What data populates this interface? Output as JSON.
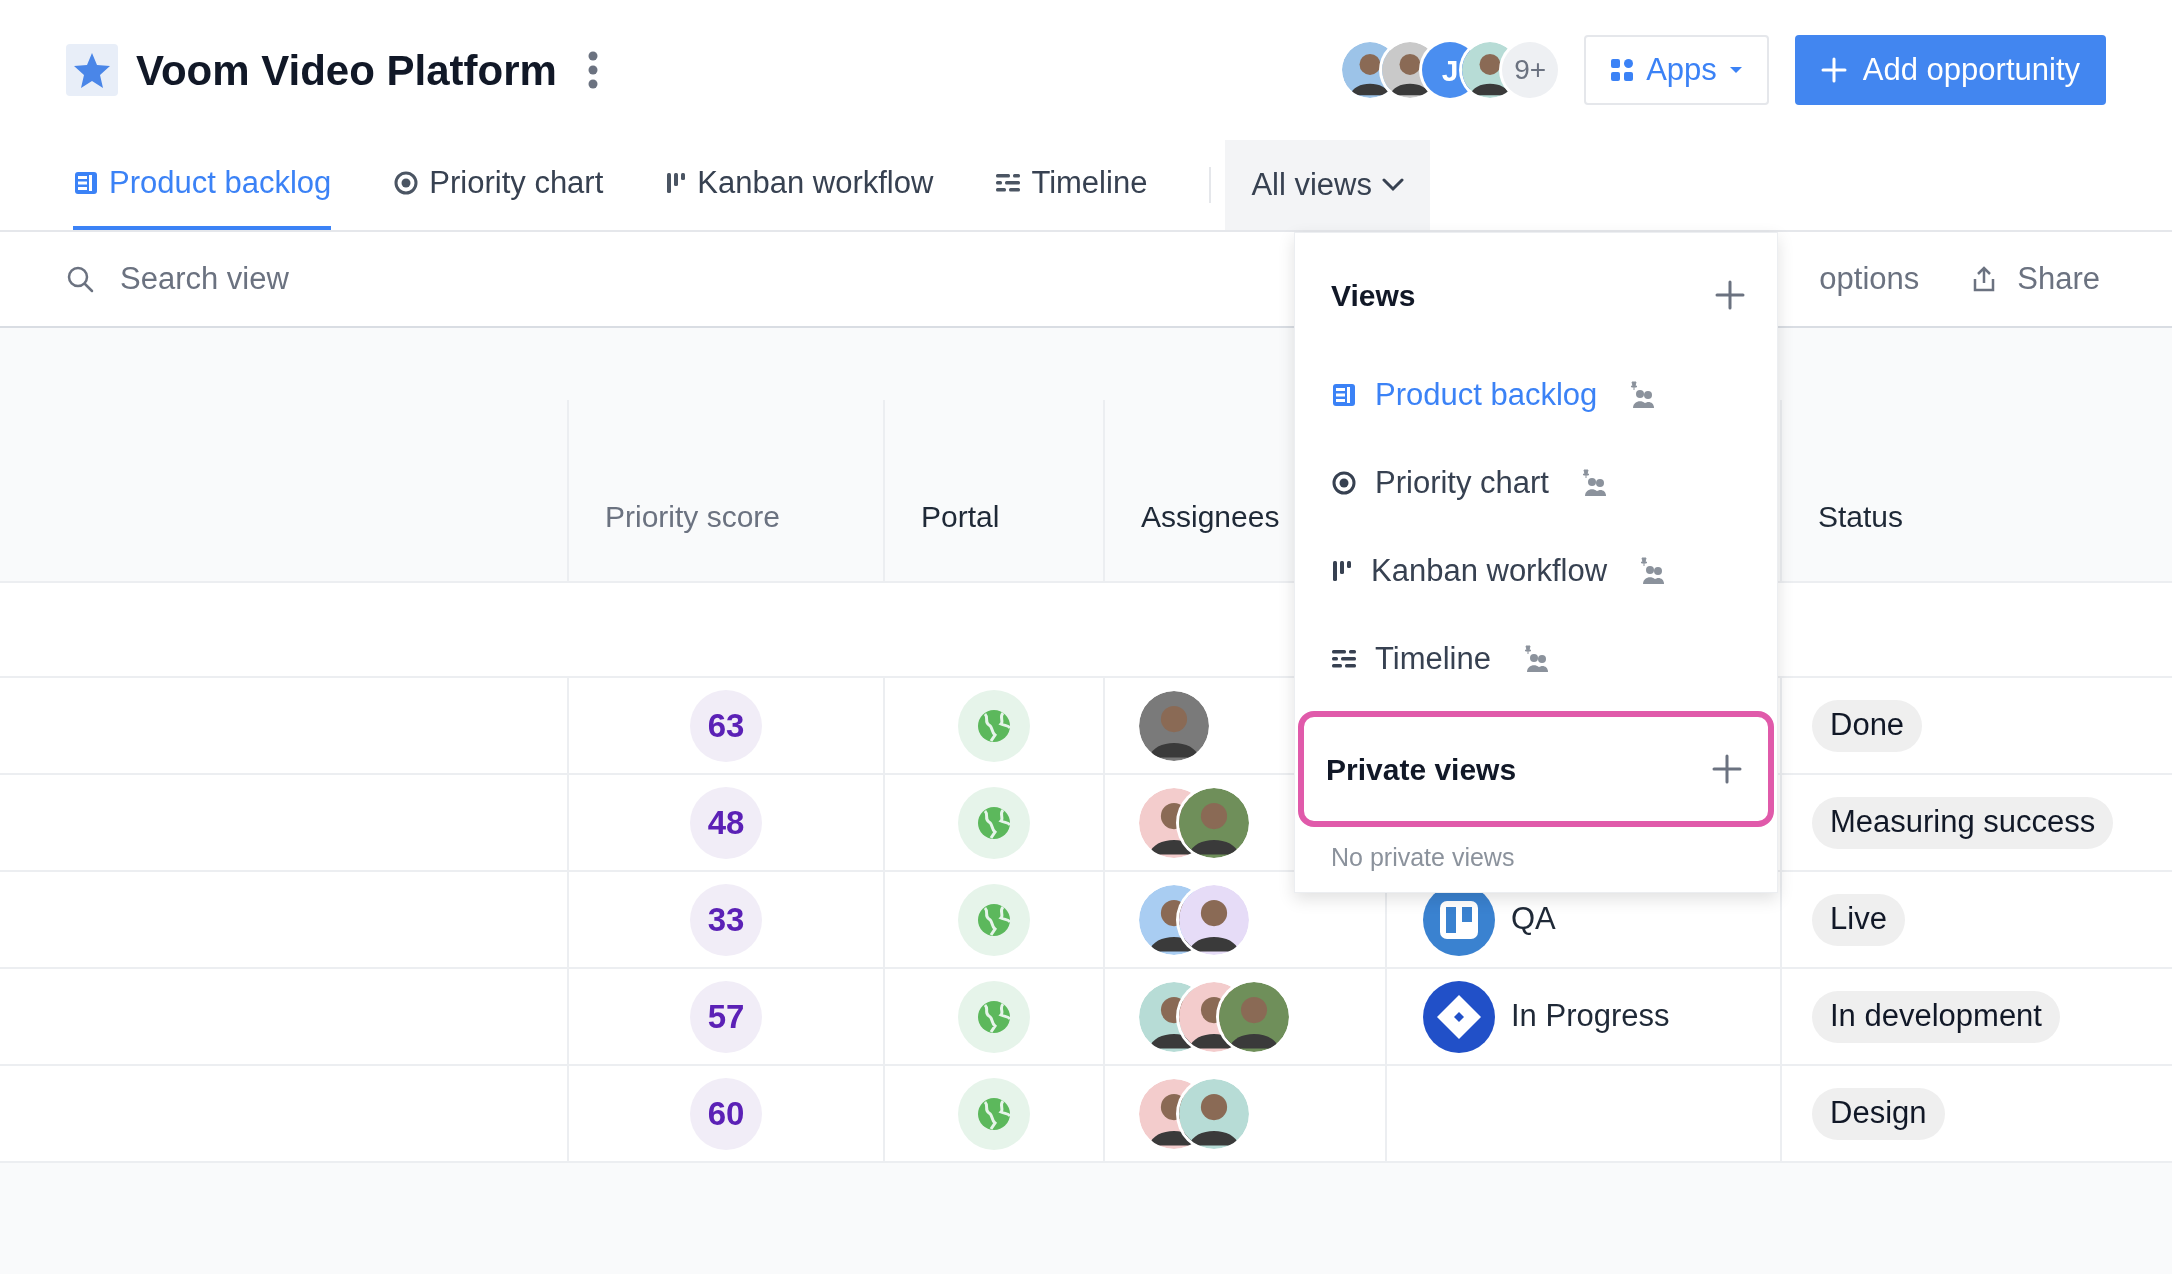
{
  "header": {
    "title": "Voom Video Platform",
    "members": [
      {
        "kind": "photo",
        "color": "#9cc3e8"
      },
      {
        "kind": "photo",
        "color": "#c9c9c9"
      },
      {
        "kind": "initial",
        "initial": "J",
        "color": "#4a8ef0"
      },
      {
        "kind": "photo",
        "color": "#b7dcd6"
      }
    ],
    "more_members": "9+",
    "apps_button": "Apps",
    "add_button": "Add opportunity"
  },
  "tabs": [
    {
      "kind": "backlog",
      "label": "Product backlog",
      "selected": true
    },
    {
      "kind": "chart",
      "label": "Priority chart",
      "selected": false
    },
    {
      "kind": "kanban",
      "label": "Kanban workflow",
      "selected": false
    },
    {
      "kind": "timeline",
      "label": "Timeline",
      "selected": false
    }
  ],
  "all_views": {
    "label": "All views",
    "expanded": true
  },
  "toolbar": {
    "search_placeholder": "Search view",
    "options_label": "options",
    "share_label": "Share"
  },
  "table": {
    "columns": [
      "Priority score",
      "Portal",
      "Assignees",
      "Status"
    ],
    "rows": [
      {
        "score": "63",
        "assignees": [
          {
            "color": "#7a7a7a"
          }
        ],
        "integration": null,
        "status": "Done"
      },
      {
        "score": "48",
        "assignees": [
          {
            "color": "#f3cccc"
          },
          {
            "color": "#6f8f5a"
          }
        ],
        "integration": null,
        "status": "Measuring success"
      },
      {
        "score": "33",
        "assignees": [
          {
            "color": "#a9cdf2"
          },
          {
            "color": "#e6dcf7"
          }
        ],
        "integration": {
          "kind": "board",
          "text": "QA"
        },
        "status": "Live"
      },
      {
        "score": "57",
        "assignees": [
          {
            "color": "#b7dcd6"
          },
          {
            "color": "#f3cccc"
          },
          {
            "color": "#6f8f5a"
          }
        ],
        "integration": {
          "kind": "diamond",
          "text": "In Progress"
        },
        "status": "In development"
      },
      {
        "score": "60",
        "assignees": [
          {
            "color": "#f3cccc"
          },
          {
            "color": "#b7dcd6"
          }
        ],
        "integration": null,
        "status": "Design"
      }
    ]
  },
  "views_menu": {
    "title": "Views",
    "items": [
      {
        "kind": "backlog",
        "label": "Product backlog",
        "selected": true,
        "shared": true
      },
      {
        "kind": "chart",
        "label": "Priority chart",
        "selected": false,
        "shared": true
      },
      {
        "kind": "kanban",
        "label": "Kanban workflow",
        "selected": false,
        "shared": true
      },
      {
        "kind": "timeline",
        "label": "Timeline",
        "selected": false,
        "shared": true
      }
    ],
    "private_title": "Private views",
    "private_highlighted": true,
    "private_empty": "No private views"
  }
}
